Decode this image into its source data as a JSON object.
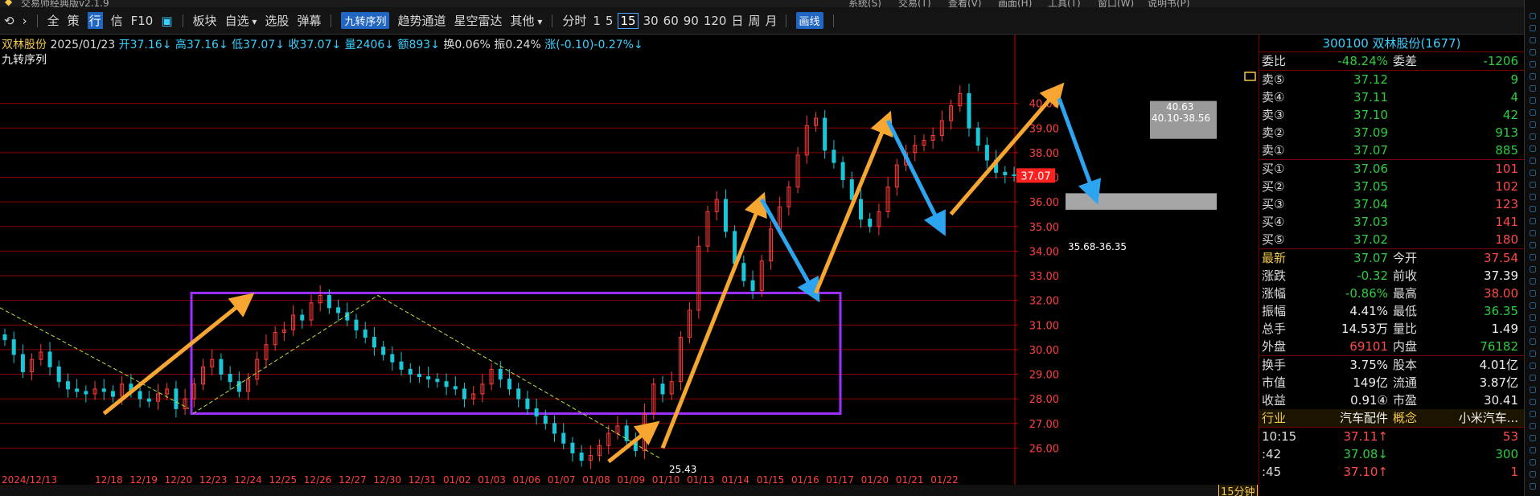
{
  "titlebar": {
    "app_title": "交易师经典版v2.1.9",
    "menus": [
      "系统(S)",
      "交易(T)",
      "查看(V)",
      "画面(H)",
      "工具(T)",
      "窗口(W)",
      "说明书(P)"
    ]
  },
  "toolbar": {
    "nav_icons": [
      "back-icon",
      "forward-icon"
    ],
    "quick": [
      "全",
      "策",
      "行",
      "信",
      "F10"
    ],
    "active_quick": "行",
    "menu_items": [
      {
        "label": "板块"
      },
      {
        "label": "自选",
        "dropdown": true
      },
      {
        "label": "选股"
      },
      {
        "label": "弹幕"
      }
    ],
    "tag_label": "九转序列",
    "features": [
      "趋势通道",
      "星空雷达"
    ],
    "other_label": "其他",
    "periods": [
      "分时",
      "1",
      "5",
      "15",
      "30",
      "60",
      "90",
      "120",
      "日",
      "周",
      "月"
    ],
    "active_period": "15",
    "draw_tag": "画线"
  },
  "quote_line": {
    "name": "双林股份",
    "date": "2025/01/23",
    "open": "开37.16↓",
    "high": "高37.16↓",
    "low": "低37.07↓",
    "close": "收37.07↓",
    "volume": "量2406↓",
    "amount": "额893↓",
    "turnover": "换0.06%",
    "amplitude": "振0.24%",
    "change": "涨(-0.10)-0.27%↓"
  },
  "indicator_label": "九转序列",
  "chart_data": {
    "type": "candlestick",
    "ylim": [
      25,
      41
    ],
    "y_ticks": [
      "40.00",
      "39.00",
      "38.00",
      "37.00",
      "36.00",
      "35.00",
      "34.00",
      "33.00",
      "32.00",
      "31.00",
      "30.00",
      "29.00",
      "28.00",
      "27.00",
      "26.00"
    ],
    "x_labels": [
      "2024/12/13",
      "12/18",
      "12/19",
      "12/20",
      "12/23",
      "12/24",
      "12/25",
      "12/26",
      "12/27",
      "12/30",
      "12/31",
      "01/02",
      "01/03",
      "01/06",
      "01/07",
      "01/08",
      "01/09",
      "01/10",
      "01/13",
      "01/14",
      "01/15",
      "01/16",
      "01/17",
      "01/20",
      "01/21",
      "01/22"
    ],
    "current_price_tag": "37.07",
    "annotations": [
      "25.43",
      "40.63",
      "40.10-38.56",
      "35.68-36.35"
    ],
    "rectangle_box": {
      "price_top": 32.3,
      "price_bottom": 27.4
    },
    "gray_zones": [
      {
        "label": "40.10-38.56",
        "high": 40.1,
        "low": 38.56
      },
      {
        "label": "35.68-36.35",
        "high": 36.35,
        "low": 35.68
      }
    ],
    "closes": [
      30.4,
      29.8,
      29.1,
      29.6,
      29.9,
      29.3,
      28.7,
      28.4,
      28.3,
      28.2,
      28.4,
      28.3,
      28.1,
      28.6,
      28.3,
      28.0,
      27.9,
      28.2,
      28.4,
      27.6,
      28.0,
      28.6,
      29.3,
      29.6,
      29.0,
      28.7,
      28.3,
      28.8,
      29.6,
      30.2,
      30.7,
      30.8,
      31.4,
      31.2,
      31.9,
      32.2,
      31.7,
      31.5,
      31.2,
      30.8,
      30.5,
      30.1,
      29.8,
      29.5,
      29.2,
      29.0,
      28.9,
      28.8,
      28.7,
      28.5,
      28.4,
      28.0,
      28.2,
      28.6,
      29.2,
      28.8,
      28.4,
      28.0,
      27.6,
      27.3,
      27.0,
      26.6,
      26.2,
      25.8,
      25.5,
      25.7,
      26.1,
      26.6,
      26.9,
      26.3,
      25.9,
      27.4,
      28.6,
      28.2,
      28.7,
      30.5,
      31.6,
      34.2,
      35.6,
      36.1,
      34.8,
      33.5,
      32.8,
      32.4,
      33.6,
      34.9,
      35.8,
      36.6,
      37.9,
      39.1,
      39.4,
      38.1,
      37.6,
      36.9,
      36.1,
      35.3,
      35.0,
      35.6,
      36.6,
      37.5,
      38.0,
      38.3,
      38.5,
      38.7,
      39.3,
      39.9,
      40.4,
      39.0,
      38.3,
      37.7,
      37.2,
      37.1,
      37.07
    ],
    "wave_arrows": [
      {
        "color": "#f7a731",
        "from": [
          11,
          27.4
        ],
        "to": [
          27,
          32.1
        ]
      },
      {
        "color": "#f7a731",
        "from": [
          67,
          25.45
        ],
        "to": [
          72,
          26.9
        ]
      },
      {
        "color": "#f7a731",
        "from": [
          73,
          26.0
        ],
        "to": [
          84,
          36.1
        ]
      },
      {
        "color": "#2da4ef",
        "from": [
          84,
          36.1
        ],
        "to": [
          90,
          32.2
        ]
      },
      {
        "color": "#f7a731",
        "from": [
          90,
          32.3
        ],
        "to": [
          98,
          39.4
        ]
      },
      {
        "color": "#2da4ef",
        "from": [
          98,
          39.3
        ],
        "to": [
          104,
          34.9
        ]
      },
      {
        "color": "#f7a731",
        "from": [
          105,
          35.5
        ],
        "to": [
          117,
          40.6
        ]
      },
      {
        "color": "#2da4ef",
        "from": [
          117,
          40.2
        ],
        "to": [
          121,
          36.2
        ]
      }
    ]
  },
  "right_panel": {
    "header": "300100 双林股份(1677)",
    "weibi": {
      "label": "委比",
      "value": "-48.24%",
      "label2": "委差",
      "value2": "-1206"
    },
    "asks": [
      {
        "label": "卖⑤",
        "price": "37.12",
        "vol": "9"
      },
      {
        "label": "卖④",
        "price": "37.11",
        "vol": "4"
      },
      {
        "label": "卖③",
        "price": "37.10",
        "vol": "42"
      },
      {
        "label": "卖②",
        "price": "37.09",
        "vol": "913"
      },
      {
        "label": "卖①",
        "price": "37.07",
        "vol": "885"
      }
    ],
    "bids": [
      {
        "label": "买①",
        "price": "37.06",
        "vol": "101"
      },
      {
        "label": "买②",
        "price": "37.05",
        "vol": "102"
      },
      {
        "label": "买③",
        "price": "37.04",
        "vol": "123"
      },
      {
        "label": "买④",
        "price": "37.03",
        "vol": "141"
      },
      {
        "label": "买⑤",
        "price": "37.02",
        "vol": "180"
      }
    ],
    "stats": [
      {
        "l1": "最新",
        "v1": "37.07",
        "c1": "green",
        "l2": "今开",
        "v2": "37.54",
        "c2": "red",
        "y1": true
      },
      {
        "l1": "涨跌",
        "v1": "-0.32",
        "c1": "green",
        "l2": "前收",
        "v2": "37.39",
        "c2": "white"
      },
      {
        "l1": "涨幅",
        "v1": "-0.86%",
        "c1": "green",
        "l2": "最高",
        "v2": "38.00",
        "c2": "red"
      },
      {
        "l1": "振幅",
        "v1": "4.41%",
        "c1": "white",
        "l2": "最低",
        "v2": "36.35",
        "c2": "green"
      },
      {
        "l1": "总手",
        "v1": "14.53万",
        "c1": "white",
        "l2": "量比",
        "v2": "1.49",
        "c2": "white"
      },
      {
        "l1": "外盘",
        "v1": "69101",
        "c1": "red",
        "l2": "内盘",
        "v2": "76182",
        "c2": "green"
      }
    ],
    "stats2": [
      {
        "l1": "换手",
        "v1": "3.75%",
        "c1": "white",
        "l2": "股本",
        "v2": "4.01亿",
        "c2": "white"
      },
      {
        "l1": "市值",
        "v1": "149亿",
        "c1": "white",
        "l2": "流通",
        "v2": "3.87亿",
        "c2": "white"
      },
      {
        "l1": "收益",
        "v1": "0.91④",
        "c1": "white",
        "l2": "市盈",
        "v2": "30.41",
        "c2": "white"
      }
    ],
    "industry": {
      "l1": "行业",
      "v1": "汽车配件",
      "l2": "概念",
      "v2": "小米汽车..."
    },
    "ticks": [
      {
        "time": "10:15",
        "price": "37.11↑",
        "pc": "red",
        "vol": "53",
        "vc": "red"
      },
      {
        "time": ":42",
        "price": "37.08↓",
        "pc": "green",
        "vol": "300",
        "vc": "green"
      },
      {
        "time": ":45",
        "price": "37.10↑",
        "pc": "red",
        "vol": "1",
        "vc": "red"
      }
    ]
  },
  "bottom": {
    "period_tab": "15分钟"
  },
  "colors": {
    "up": "#ff3b3b",
    "down": "#2ecc40",
    "axis_red": "#8a0000",
    "box": "#9b30ff"
  }
}
